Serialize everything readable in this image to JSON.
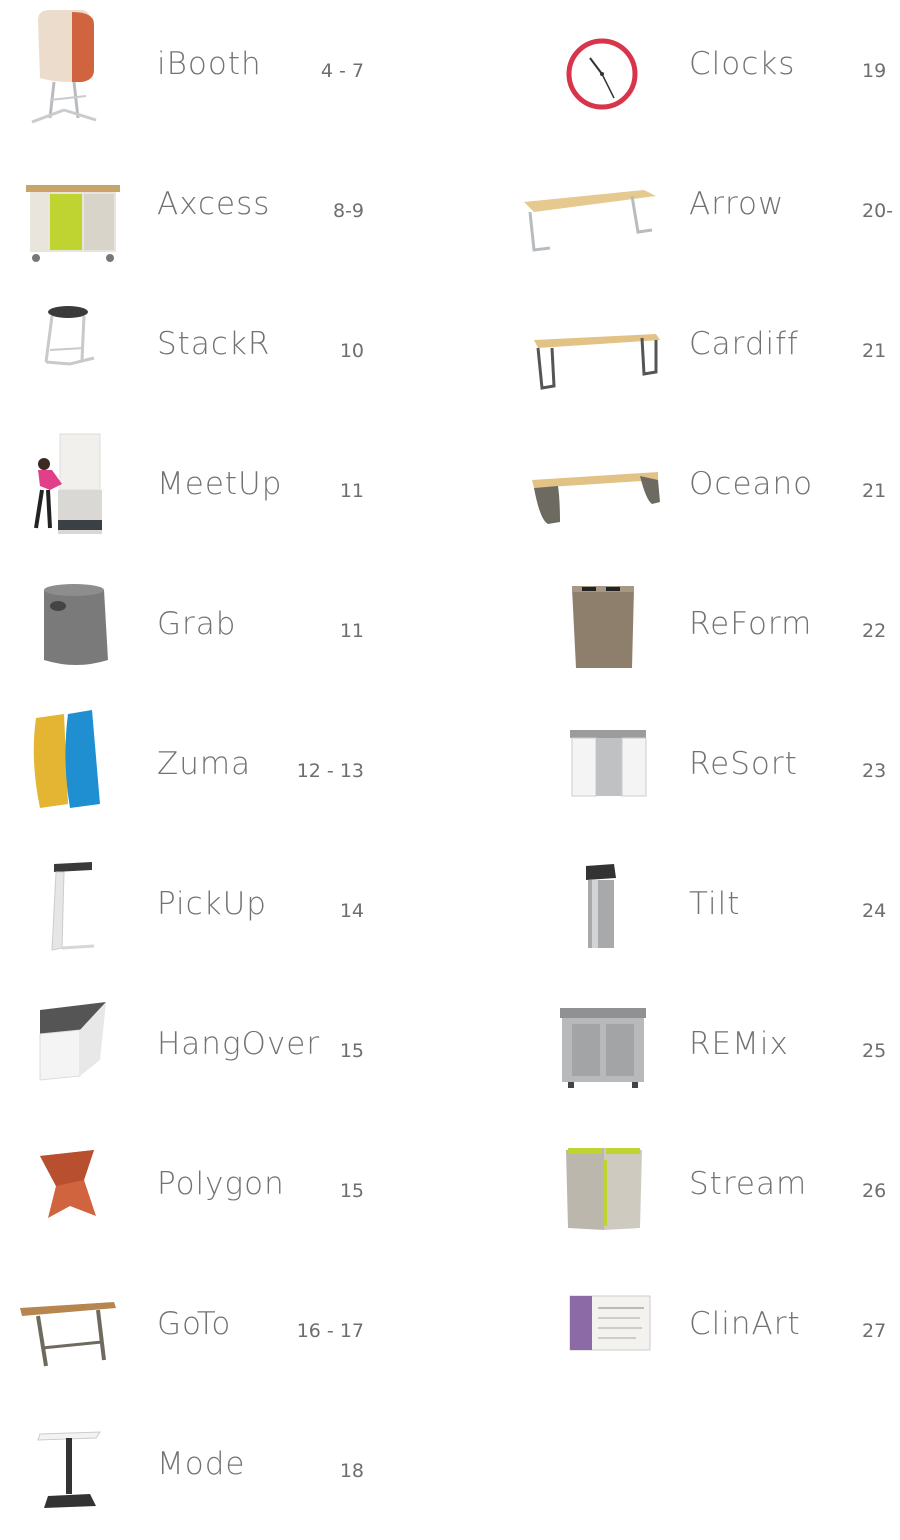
{
  "left_items": [
    {
      "name": "iBooth",
      "pages": "4 - 7",
      "icon": "iBooth-product-icon"
    },
    {
      "name": "Axcess",
      "pages": "8-9",
      "icon": "axcess-product-icon"
    },
    {
      "name": "StackR",
      "pages": "10",
      "icon": "stackr-product-icon"
    },
    {
      "name": "MeetUp",
      "pages": "11",
      "icon": "meetup-product-icon"
    },
    {
      "name": "Grab",
      "pages": "11",
      "icon": "grab-product-icon"
    },
    {
      "name": "Zuma",
      "pages": "12 - 13",
      "icon": "zuma-product-icon"
    },
    {
      "name": "PickUp",
      "pages": "14",
      "icon": "pickup-product-icon"
    },
    {
      "name": "HangOver",
      "pages": "15",
      "icon": "hangover-product-icon"
    },
    {
      "name": "Polygon",
      "pages": "15",
      "icon": "polygon-product-icon"
    },
    {
      "name": "GoTo",
      "pages": "16 - 17",
      "icon": "goto-product-icon"
    },
    {
      "name": "Mode",
      "pages": "18",
      "icon": "mode-product-icon"
    }
  ],
  "right_items": [
    {
      "name": "Clocks",
      "pages": "19",
      "icon": "clock-product-icon"
    },
    {
      "name": "Arrow",
      "pages": "20-",
      "icon": "arrow-bench-product-icon"
    },
    {
      "name": "Cardiff",
      "pages": "21",
      "icon": "cardiff-bench-product-icon"
    },
    {
      "name": "Oceano",
      "pages": "21",
      "icon": "oceano-bench-product-icon"
    },
    {
      "name": "ReForm",
      "pages": "22",
      "icon": "reform-bin-product-icon"
    },
    {
      "name": "ReSort",
      "pages": "23",
      "icon": "resort-bin-product-icon"
    },
    {
      "name": "Tilt",
      "pages": "24",
      "icon": "tilt-bin-product-icon"
    },
    {
      "name": "REMix",
      "pages": "25",
      "icon": "remix-bin-product-icon"
    },
    {
      "name": "Stream",
      "pages": "26",
      "icon": "stream-bin-product-icon"
    },
    {
      "name": "ClinArt",
      "pages": "27",
      "icon": "clinart-panel-product-icon"
    }
  ],
  "colors": {
    "text": "#727272",
    "orange": "#d0643f",
    "yellow": "#e3b533",
    "blue": "#1f8fd2",
    "lime": "#bfd331",
    "wood": "#e6c98f",
    "steel": "#b9bcbf",
    "clock_red": "#d8344b"
  }
}
